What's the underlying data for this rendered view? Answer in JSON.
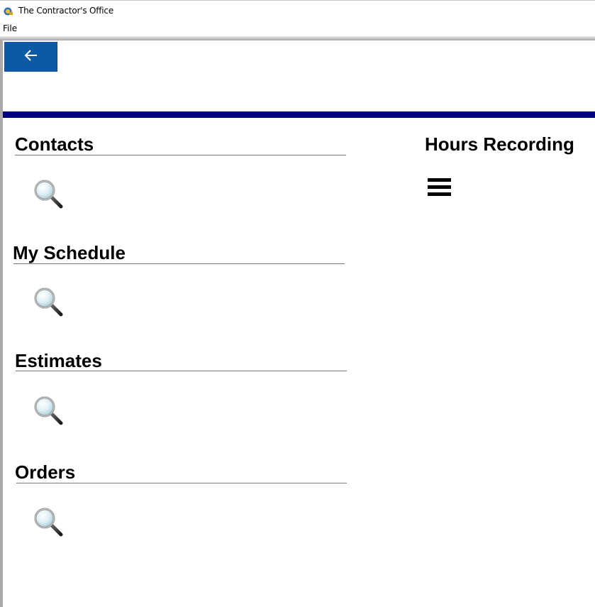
{
  "window": {
    "title": "The Contractor's Office",
    "icon": "app-logo-icon"
  },
  "menubar": {
    "items": [
      "File"
    ]
  },
  "toolbar": {
    "back_icon": "arrow-left-icon",
    "accent_color": "#0c5aa6"
  },
  "header": {
    "rule_color": "#00007f"
  },
  "sections": [
    {
      "title": "Contacts",
      "icon": "search-icon"
    },
    {
      "title": "My Schedule",
      "icon": "search-icon"
    },
    {
      "title": "Estimates",
      "icon": "search-icon"
    },
    {
      "title": "Orders",
      "icon": "search-icon"
    }
  ],
  "hours": {
    "title": "Hours Recording",
    "icon": "menu-icon"
  }
}
